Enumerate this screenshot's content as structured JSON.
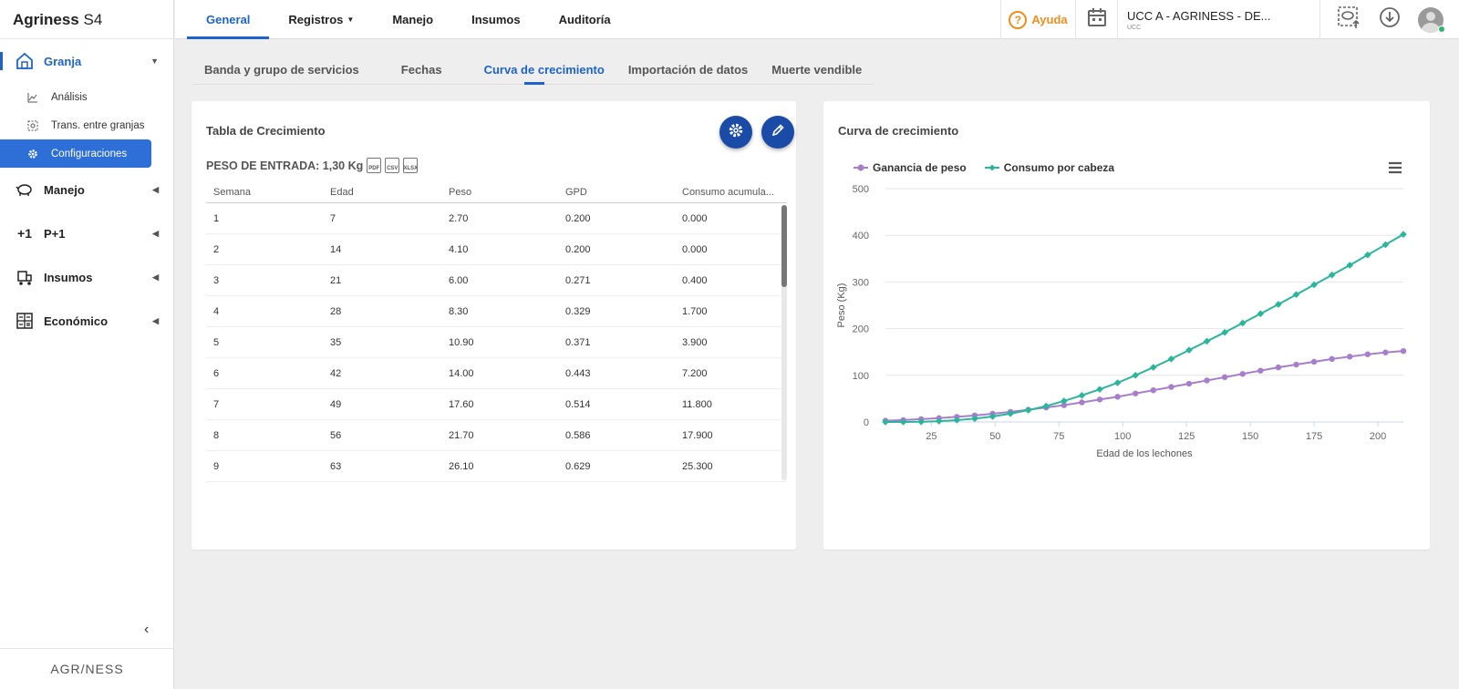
{
  "app": {
    "name": "Agriness",
    "edition": "S4"
  },
  "sidebar": {
    "groups": [
      {
        "label": "Granja",
        "icon": "barn-icon"
      },
      {
        "label": "Manejo",
        "icon": "pig-icon"
      },
      {
        "label": "P+1",
        "icon": "plus-one-icon"
      },
      {
        "label": "Insumos",
        "icon": "cart-icon"
      },
      {
        "label": "Económico",
        "icon": "calculator-icon"
      }
    ],
    "granja_items": [
      {
        "label": "Análisis",
        "icon": "chart-line-icon"
      },
      {
        "label": "Trans. entre granjas",
        "icon": "transfer-icon"
      },
      {
        "label": "Configuraciones",
        "icon": "gear-icon"
      }
    ],
    "footer": "AGR/NESS"
  },
  "topnav": {
    "tabs": [
      "General",
      "Registros",
      "Manejo",
      "Insumos",
      "Auditoría"
    ],
    "help_label": "Ayuda",
    "farm_name": "UCC A - AGRINESS - DE...",
    "farm_sub": "UCC"
  },
  "subtabs": [
    "Banda y grupo de servicios",
    "Fechas",
    "Curva de crecimiento",
    "Importación de datos",
    "Muerte vendible"
  ],
  "table_card": {
    "title": "Tabla de Crecimiento",
    "peso_entrada": "PESO DE ENTRADA: 1,30 Kg",
    "exports": [
      "PDF",
      "CSV",
      "XLSX"
    ],
    "columns": [
      "Semana",
      "Edad",
      "Peso",
      "GPD",
      "Consumo acumula..."
    ],
    "rows": [
      [
        "1",
        "7",
        "2.70",
        "0.200",
        "0.000"
      ],
      [
        "2",
        "14",
        "4.10",
        "0.200",
        "0.000"
      ],
      [
        "3",
        "21",
        "6.00",
        "0.271",
        "0.400"
      ],
      [
        "4",
        "28",
        "8.30",
        "0.329",
        "1.700"
      ],
      [
        "5",
        "35",
        "10.90",
        "0.371",
        "3.900"
      ],
      [
        "6",
        "42",
        "14.00",
        "0.443",
        "7.200"
      ],
      [
        "7",
        "49",
        "17.60",
        "0.514",
        "11.800"
      ],
      [
        "8",
        "56",
        "21.70",
        "0.586",
        "17.900"
      ],
      [
        "9",
        "63",
        "26.10",
        "0.629",
        "25.300"
      ]
    ]
  },
  "chart_card": {
    "title": "Curva de crecimiento"
  },
  "chart_data": {
    "type": "line",
    "xlabel": "Edad de los lechones",
    "ylabel": "Peso (Kg)",
    "xlim": [
      7,
      210
    ],
    "ylim": [
      0,
      500
    ],
    "xticks": [
      25,
      50,
      75,
      100,
      125,
      150,
      175,
      200
    ],
    "yticks": [
      0,
      100,
      200,
      300,
      400,
      500
    ],
    "legend": "top-left",
    "x": [
      7,
      14,
      21,
      28,
      35,
      42,
      49,
      56,
      63,
      70,
      77,
      84,
      91,
      98,
      105,
      112,
      119,
      126,
      133,
      140,
      147,
      154,
      161,
      168,
      175,
      182,
      189,
      196,
      203,
      210
    ],
    "series": [
      {
        "name": "Ganancia de peso",
        "color": "#a77ecb",
        "values": [
          2.7,
          4.1,
          6.0,
          8.3,
          10.9,
          14.0,
          17.6,
          21.7,
          26.1,
          31,
          36,
          42,
          48,
          54,
          61,
          68,
          75,
          82,
          89,
          96,
          103,
          110,
          117,
          123,
          129,
          135,
          140,
          145,
          149,
          152
        ]
      },
      {
        "name": "Consumo por cabeza",
        "color": "#2bb59a",
        "values": [
          0,
          0,
          0.4,
          1.7,
          3.9,
          7.2,
          11.8,
          17.9,
          25.3,
          34,
          45,
          57,
          70,
          84,
          100,
          117,
          135,
          154,
          173,
          192,
          212,
          232,
          252,
          273,
          294,
          315,
          336,
          358,
          380,
          402
        ]
      }
    ]
  }
}
